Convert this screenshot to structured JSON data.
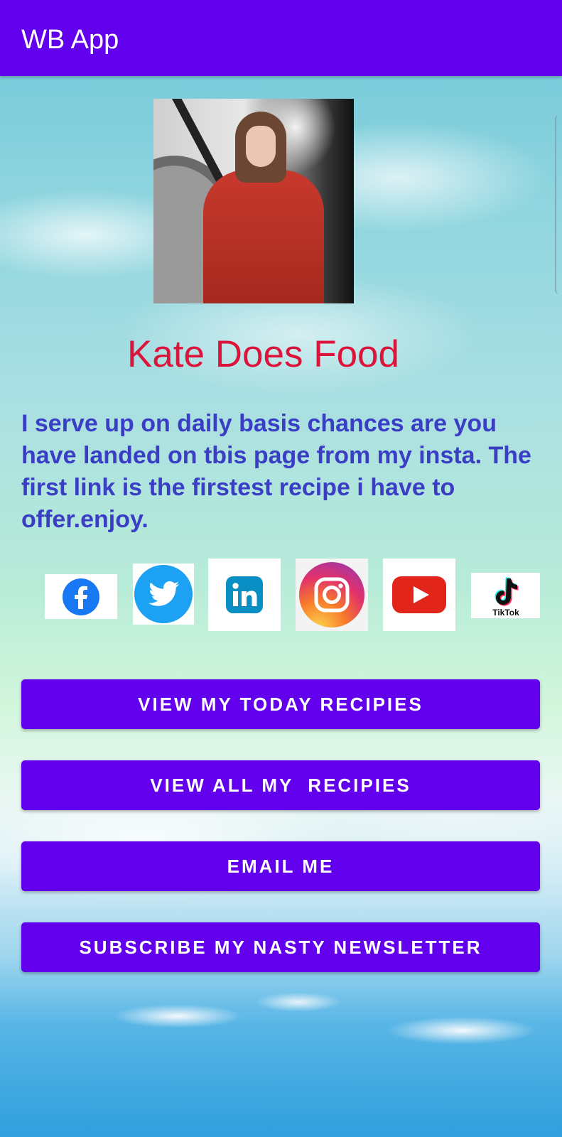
{
  "app_bar": {
    "title": "WB App",
    "color": "#6200ee"
  },
  "profile": {
    "name": "Kate Does Food",
    "name_color": "#dc143c",
    "bio": "I serve up on daily basis chances are you have landed on tbis page from my insta. The first link is the firstest recipe i have to offer.enjoy.",
    "bio_color": "#3a3ec4"
  },
  "social_icons": [
    {
      "icon": "facebook-icon"
    },
    {
      "icon": "twitter-icon"
    },
    {
      "icon": "linkedin-icon"
    },
    {
      "icon": "instagram-icon"
    },
    {
      "icon": "youtube-icon"
    },
    {
      "icon": "tiktok-icon",
      "label": "TikTok"
    }
  ],
  "buttons": {
    "today_recipes": "VIEW MY TODAY RECIPIES",
    "all_recipes": "VIEW ALL MY  RECIPIES",
    "email": "EMAIL ME",
    "newsletter": "SUBSCRIBE MY NASTY NEWSLETTER"
  }
}
